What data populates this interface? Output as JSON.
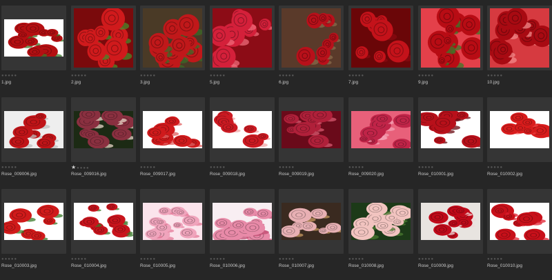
{
  "grid": {
    "items": [
      {
        "filename": "1.jpg",
        "rating": 0,
        "bg": "#ffffff",
        "tone": "#b40f12",
        "accent": "#3a7a2a",
        "shape": "wide"
      },
      {
        "filename": "2.jpg",
        "rating": 0,
        "bg": "#7a0a0c",
        "tone": "#d01a1c",
        "accent": "#4a8a2a",
        "shape": "tall"
      },
      {
        "filename": "3.jpg",
        "rating": 0,
        "bg": "#4a3a26",
        "tone": "#c0181a",
        "accent": "#3c6a28",
        "shape": "tall"
      },
      {
        "filename": "5.jpg",
        "rating": 0,
        "bg": "#8c0c16",
        "tone": "#d4203a",
        "accent": "#f06a7a",
        "shape": "tall"
      },
      {
        "filename": "6.jpg",
        "rating": 0,
        "bg": "#5a3a2a",
        "tone": "#b8101a",
        "accent": "#8a6a4a",
        "shape": "tall"
      },
      {
        "filename": "7.jpg",
        "rating": 0,
        "bg": "#6a0608",
        "tone": "#c4121a",
        "accent": "#8a0a10",
        "shape": "tall"
      },
      {
        "filename": "9.jpg",
        "rating": 0,
        "bg": "#e4404a",
        "tone": "#b80c14",
        "accent": "#3a7a28",
        "shape": "tall"
      },
      {
        "filename": "10.jpg",
        "rating": 0,
        "bg": "#d63a40",
        "tone": "#a80a12",
        "accent": "#f28a8a",
        "shape": "tall"
      },
      {
        "filename": "Rose_009006.jpg",
        "rating": 0,
        "bg": "#eeeeee",
        "tone": "#c01418",
        "accent": "#bdbdbd",
        "shape": "wide"
      },
      {
        "filename": "Rose_009016.jpg",
        "rating": 1,
        "bg": "#1c2a14",
        "tone": "#8a3040",
        "accent": "#e8d8c8",
        "shape": "wide"
      },
      {
        "filename": "Rose_009017.jpg",
        "rating": 0,
        "bg": "#ffffff",
        "tone": "#d01a1c",
        "accent": "#e06060",
        "shape": "wide"
      },
      {
        "filename": "Rose_009018.jpg",
        "rating": 0,
        "bg": "#ffffff",
        "tone": "#cc1a22",
        "accent": "#f0a8a8",
        "shape": "wide"
      },
      {
        "filename": "Rose_009019.jpg",
        "rating": 0,
        "bg": "#6a0a1a",
        "tone": "#b0203a",
        "accent": "#d85a70",
        "shape": "wide"
      },
      {
        "filename": "Rose_009020.jpg",
        "rating": 0,
        "bg": "#e8607a",
        "tone": "#c02448",
        "accent": "#f4a0b4",
        "shape": "wide"
      },
      {
        "filename": "Rose_010001.jpg",
        "rating": 0,
        "bg": "#ffffff",
        "tone": "#b8101a",
        "accent": "#6a0a10",
        "shape": "wide"
      },
      {
        "filename": "Rose_010002.jpg",
        "rating": 0,
        "bg": "#ffffff",
        "tone": "#d81c1c",
        "accent": "#f04040",
        "shape": "wide"
      },
      {
        "filename": "Rose_010003.jpg",
        "rating": 0,
        "bg": "#ffffff",
        "tone": "#d01a1a",
        "accent": "#3a7a28",
        "shape": "wide"
      },
      {
        "filename": "Rose_010004.jpg",
        "rating": 0,
        "bg": "#ffffff",
        "tone": "#c8141c",
        "accent": "#3a7a28",
        "shape": "wide"
      },
      {
        "filename": "Rose_010005.jpg",
        "rating": 0,
        "bg": "#fbe4ec",
        "tone": "#f0a4bc",
        "accent": "#e47a98",
        "shape": "wide"
      },
      {
        "filename": "Rose_010006.jpg",
        "rating": 0,
        "bg": "#f8eef2",
        "tone": "#e88aa8",
        "accent": "#c04a70",
        "shape": "wide"
      },
      {
        "filename": "Rose_010007.jpg",
        "rating": 0,
        "bg": "#3a2a20",
        "tone": "#e8b0b4",
        "accent": "#c89a60",
        "shape": "wide"
      },
      {
        "filename": "Rose_010008.jpg",
        "rating": 0,
        "bg": "#1c3a18",
        "tone": "#f2c4c0",
        "accent": "#4a7a30",
        "shape": "wide"
      },
      {
        "filename": "Rose_010009.jpg",
        "rating": 0,
        "bg": "#e8e4e0",
        "tone": "#c00a1a",
        "accent": "#f0d8d8",
        "shape": "wide"
      },
      {
        "filename": "Rose_010010.jpg",
        "rating": 0,
        "bg": "#ffffff",
        "tone": "#c8101a",
        "accent": "#e02030",
        "shape": "wide"
      }
    ]
  },
  "icons": {
    "rating_star": "star-icon"
  }
}
